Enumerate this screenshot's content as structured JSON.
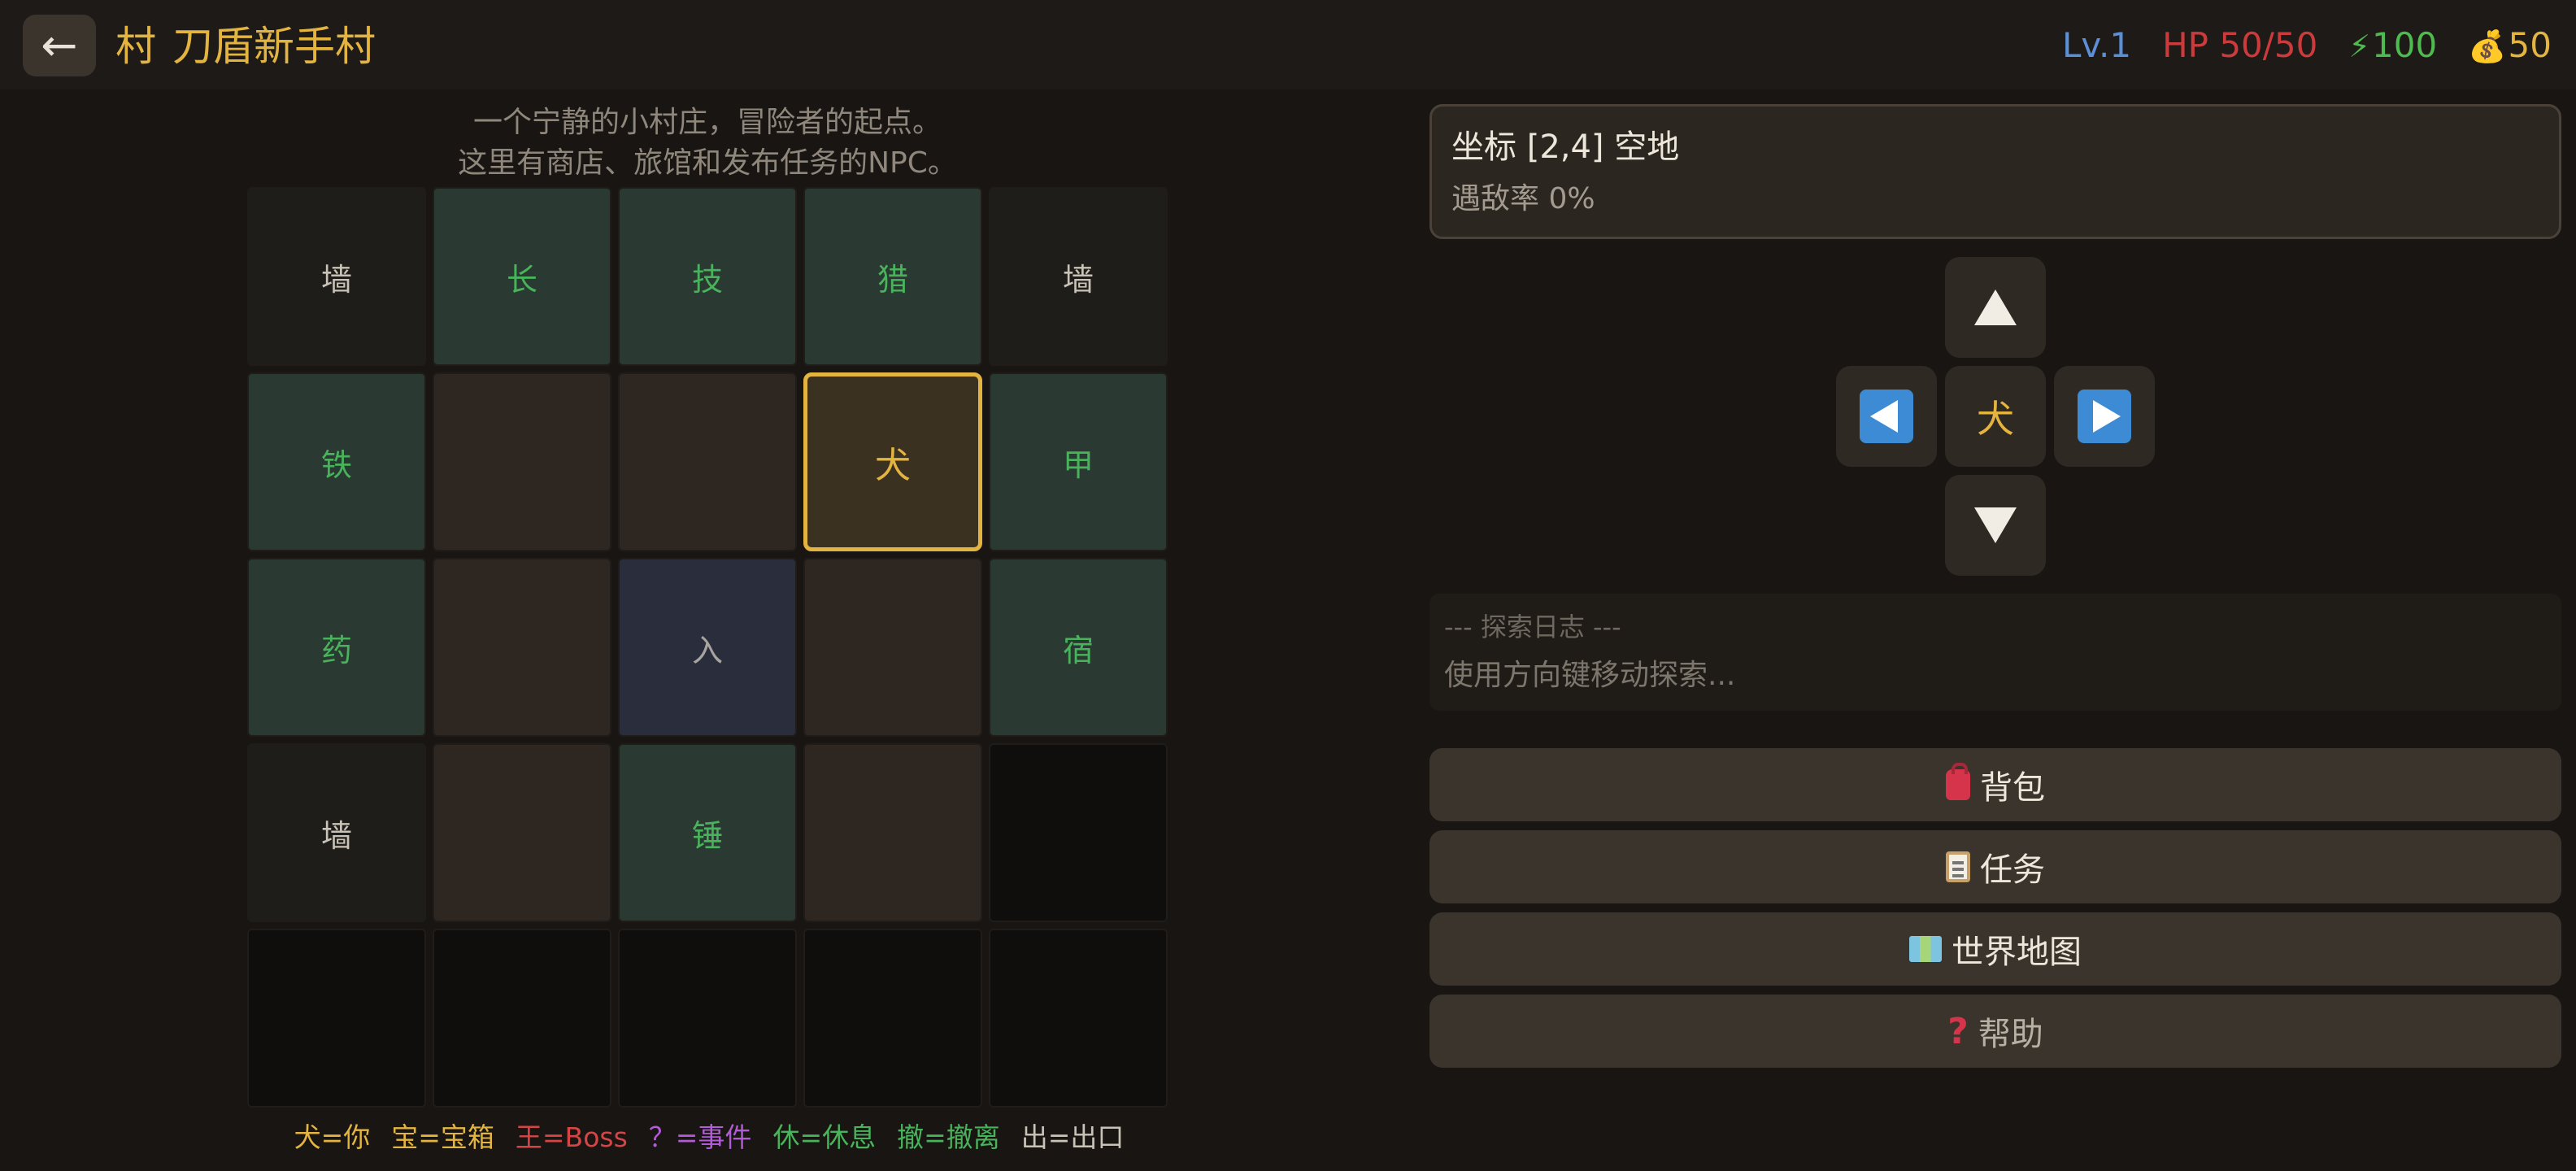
{
  "header": {
    "back_icon": "arrow-left-icon",
    "village_char": "村",
    "area_name": "刀盾新手村",
    "level": "Lv.1",
    "hp": "HP 50/50",
    "energy_icon": "⚡",
    "energy": "100",
    "gold_icon": "💰",
    "gold": "50"
  },
  "map": {
    "description_line1": "一个宁静的小村庄，冒险者的起点。",
    "description_line2": "这里有商店、旅馆和发布任务的NPC。",
    "rows": [
      [
        {
          "type": "wall",
          "label": "墙"
        },
        {
          "type": "npc",
          "label": "长"
        },
        {
          "type": "npc",
          "label": "技"
        },
        {
          "type": "npc",
          "label": "猎"
        },
        {
          "type": "wall",
          "label": "墙"
        }
      ],
      [
        {
          "type": "npc",
          "label": "铁"
        },
        {
          "type": "floor",
          "label": ""
        },
        {
          "type": "floor",
          "label": ""
        },
        {
          "type": "player",
          "label": "犬"
        },
        {
          "type": "npc",
          "label": "甲"
        }
      ],
      [
        {
          "type": "npc",
          "label": "药"
        },
        {
          "type": "floor",
          "label": ""
        },
        {
          "type": "entrance",
          "label": "入"
        },
        {
          "type": "floor",
          "label": ""
        },
        {
          "type": "npc",
          "label": "宿"
        }
      ],
      [
        {
          "type": "wall",
          "label": "墙"
        },
        {
          "type": "floor",
          "label": ""
        },
        {
          "type": "npc",
          "label": "锤"
        },
        {
          "type": "floor",
          "label": ""
        },
        {
          "type": "empty",
          "label": ""
        }
      ],
      [
        {
          "type": "empty",
          "label": ""
        },
        {
          "type": "empty",
          "label": ""
        },
        {
          "type": "empty",
          "label": ""
        },
        {
          "type": "empty",
          "label": ""
        },
        {
          "type": "empty",
          "label": ""
        }
      ]
    ]
  },
  "legend": {
    "player": "犬=你",
    "chest": "宝=宝箱",
    "boss": "王=Boss",
    "event": "？=事件",
    "rest": "休=休息",
    "retreat": "撤=撤离",
    "exit": "出=出口"
  },
  "info": {
    "coordinate": "坐标 [2,4]  空地",
    "encounter_rate": "遇敌率 0%"
  },
  "dpad": {
    "center": "犬"
  },
  "log": {
    "title": "--- 探索日志 ---",
    "line1": "使用方向键移动探索..."
  },
  "menu": {
    "bag": "背包",
    "quest": "任务",
    "world_map": "世界地图",
    "help": "帮助"
  },
  "colors": {
    "accent": "#e3b440",
    "hp": "#cc3b3b",
    "level": "#5b8fd6",
    "energy": "#4fbb4f",
    "npc": "#49b35c"
  }
}
